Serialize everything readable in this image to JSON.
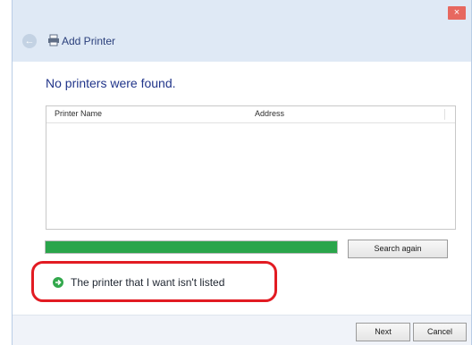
{
  "window": {
    "title": "Add Printer",
    "close_glyph": "×",
    "back_glyph": "←"
  },
  "heading": "No printers were found.",
  "table": {
    "columns": [
      "Printer Name",
      "Address"
    ],
    "rows": []
  },
  "progress": {
    "fraction": 1.0,
    "color": "#2aa54b"
  },
  "buttons": {
    "search_again": "Search again",
    "next": "Next",
    "cancel": "Cancel"
  },
  "link": {
    "text": "The printer that I want isn't listed"
  },
  "colors": {
    "heading": "#21358a",
    "highlight": "#e21b22",
    "close": "#e7685f"
  },
  "icons": {
    "printer": "printer-icon",
    "arrow": "green-arrow-icon",
    "back": "back-arrow-icon",
    "close": "close-icon"
  }
}
